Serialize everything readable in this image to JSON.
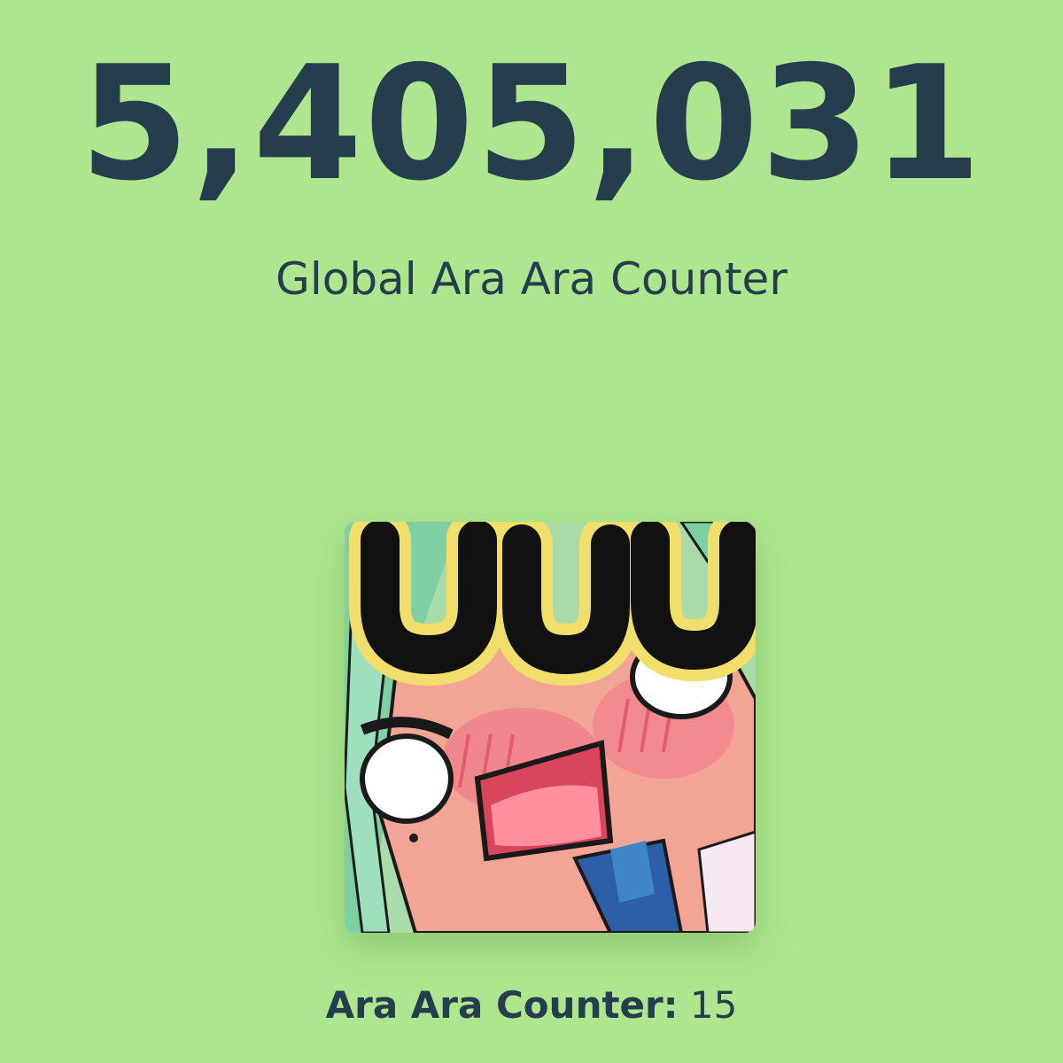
{
  "global_counter": {
    "value": "5,405,031",
    "label": "Global Ara Ara Counter"
  },
  "avatar": {
    "icon": "anime-girl-blushing-emote-icon"
  },
  "personal_counter": {
    "label": "Ara Ara Counter:",
    "value": "15"
  },
  "colors": {
    "background": "#ade68e",
    "text": "#263d4d"
  }
}
